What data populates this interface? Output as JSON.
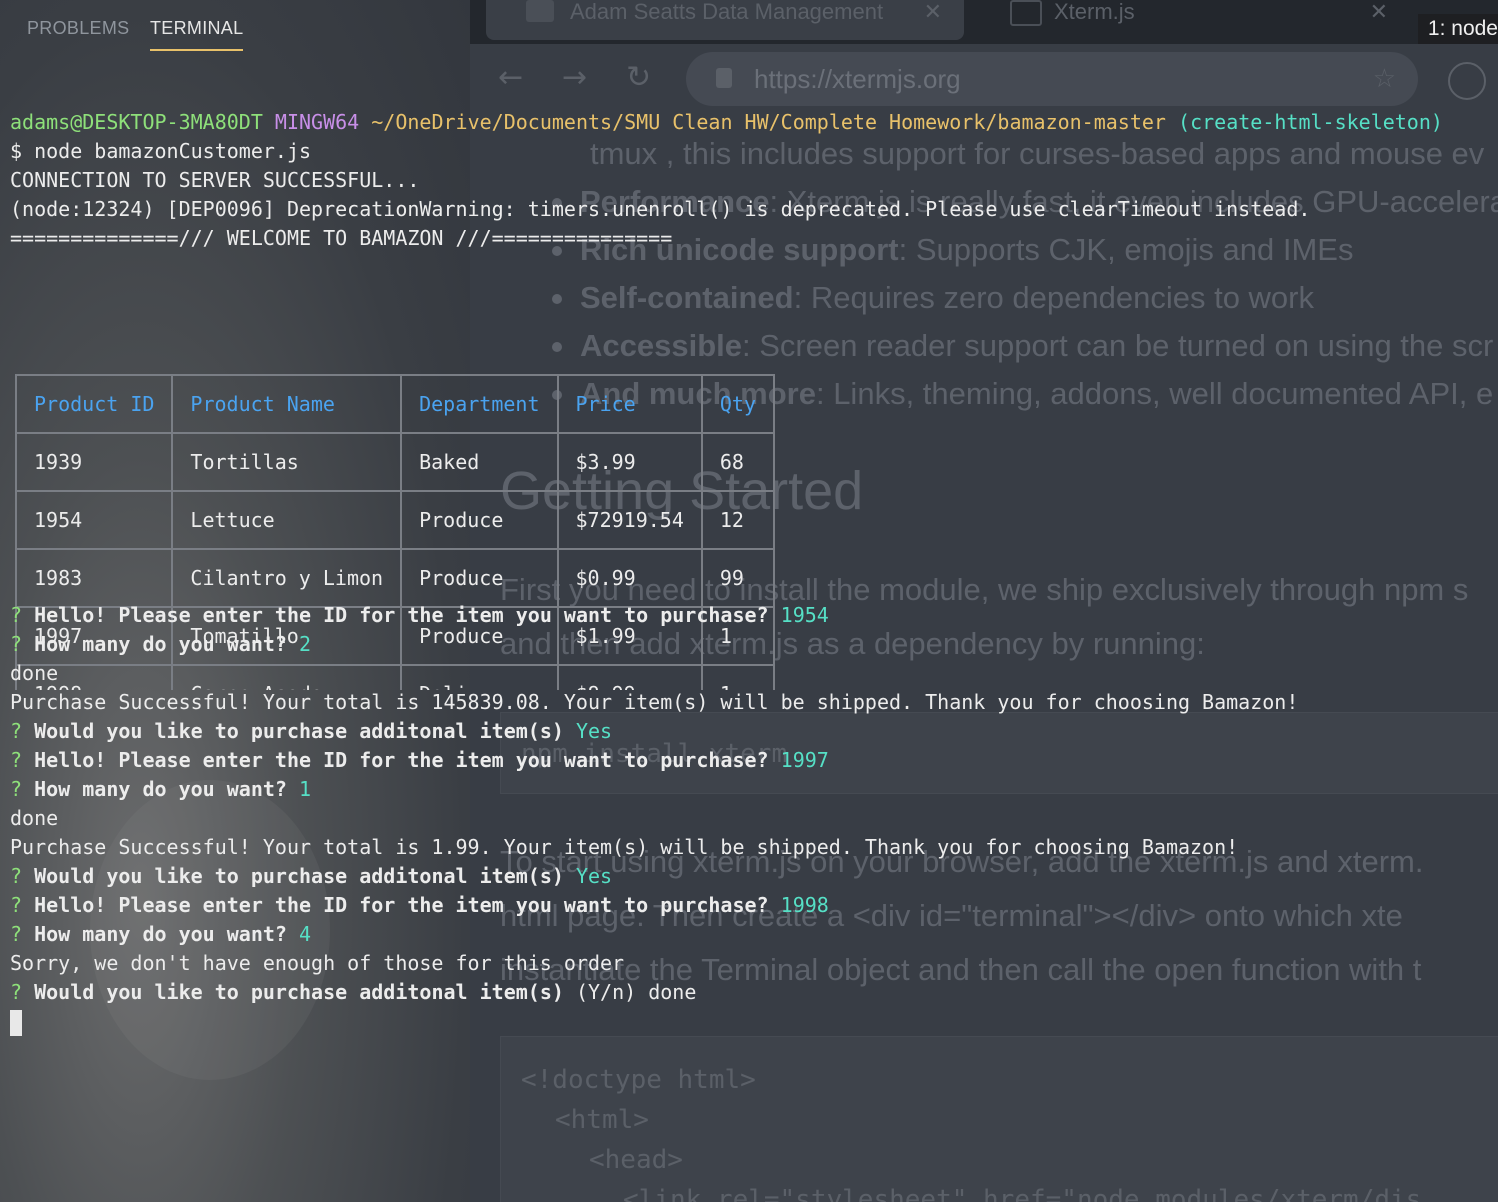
{
  "background_browser": {
    "tabs": [
      {
        "label": "Adam Seatts Data Management"
      },
      {
        "label": "Xterm.js"
      }
    ],
    "url": "https://xtermjs.org",
    "content_lines": [
      {
        "text": "tmux , this includes support for curses-based apps and mouse ev"
      },
      {
        "bold": "Performance",
        "text": ": Xterm.js is really fast, it even includes GPU-accelera"
      },
      {
        "bold": "Rich unicode support",
        "text": ": Supports CJK, emojis and IMEs"
      },
      {
        "bold": "Self-contained",
        "text": ": Requires zero dependencies to work"
      },
      {
        "bold": "Accessible",
        "text": ": Screen reader support can be turned on using the scr"
      },
      {
        "bold": "And much more",
        "text": ": Links, theming, addons, well documented API, e"
      }
    ],
    "heading": "Getting Started",
    "para1": "First you need to install the module, we ship exclusively through npm s",
    "para2": "and then add xterm.js as a dependency by running:",
    "code1": "npm install xterm",
    "para3": "To start using xterm.js on your browser, add the xterm.js and xterm.",
    "para4": "html page. Then create a <div id=\"terminal\"></div> onto which xte",
    "para5": "instantiate the Terminal object and then call the open function with t",
    "code2": [
      "<!doctype html>",
      "<html>",
      "<head>",
      "<link rel=\"stylesheet\" href=\"node_modules/xterm/dis"
    ]
  },
  "panel": {
    "tabs": [
      {
        "label": "PROBLEMS",
        "active": false
      },
      {
        "label": "TERMINAL",
        "active": true
      }
    ],
    "terminal_select": "1: node"
  },
  "terminal": {
    "prompt": {
      "user": "adams@DESKTOP-3MA80DT",
      "env": "MINGW64",
      "path": "~/OneDrive/Documents/SMU Clean HW/Complete Homework/bamazon-master",
      "branch": "(create-html-skeleton)"
    },
    "command": "$ node bamazonCustomer.js",
    "out1": "CONNECTION TO SERVER SUCCESSFUL...",
    "out2": "(node:12324) [DEP0096] DeprecationWarning: timers.unenroll() is deprecated. Please use clearTimeout instead.",
    "out3": "==============/// WELCOME TO BAMAZON ///===============",
    "table": {
      "headers": [
        "Product ID",
        "Product Name",
        "Department",
        "Price",
        "Qty"
      ],
      "rows": [
        [
          "1939",
          "Tortillas",
          "Baked",
          "$3.99",
          "68"
        ],
        [
          "1954",
          "Lettuce",
          "Produce",
          "$72919.54",
          "12"
        ],
        [
          "1983",
          "Cilantro y Limon",
          "Produce",
          "$0.99",
          "99"
        ],
        [
          "1997",
          "Tomatillo",
          "Produce",
          "$1.99",
          "1"
        ],
        [
          "1998",
          "Carne Asada",
          "Deli",
          "$8.99",
          "1"
        ]
      ]
    },
    "dialog": [
      {
        "q": "? ",
        "text": "Hello! Please enter the ID for the item you want to purchase?",
        "answer": " 1954"
      },
      {
        "q": "? ",
        "text": "How many do you want?",
        "answer": " 2"
      },
      {
        "plain": "done"
      },
      {
        "plain": "Purchase Successful! Your total is 145839.08. Your item(s) will be shipped. Thank you for choosing Bamazon!"
      },
      {
        "q": "? ",
        "text": "Would you like to purchase additonal item(s)",
        "answer": " Yes"
      },
      {
        "q": "? ",
        "text": "Hello! Please enter the ID for the item you want to purchase?",
        "answer": " 1997"
      },
      {
        "q": "? ",
        "text": "How many do you want?",
        "answer": " 1"
      },
      {
        "plain": "done"
      },
      {
        "plain": "Purchase Successful! Your total is 1.99. Your item(s) will be shipped. Thank you for choosing Bamazon!"
      },
      {
        "q": "? ",
        "text": "Would you like to purchase additonal item(s)",
        "answer": " Yes"
      },
      {
        "q": "? ",
        "text": "Hello! Please enter the ID for the item you want to purchase?",
        "answer": " 1998"
      },
      {
        "q": "? ",
        "text": "How many do you want?",
        "answer": " 4"
      },
      {
        "plain": "Sorry, we don't have enough of those for this order"
      },
      {
        "q": "? ",
        "text": "Would you like to purchase additonal item(s)",
        "plain_tail": " (Y/n) done"
      }
    ]
  }
}
